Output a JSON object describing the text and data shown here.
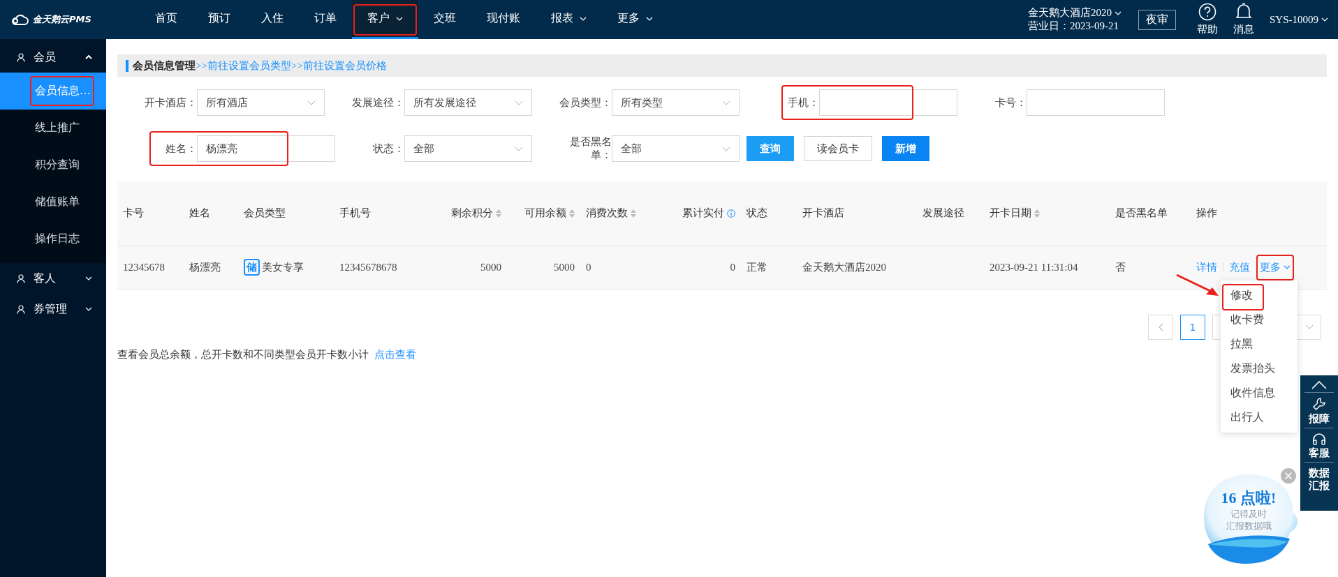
{
  "app": {
    "logo": "金天鹅云PMS"
  },
  "nav": [
    {
      "label": "首页",
      "selected": false,
      "dropdown": false,
      "highlighted": false
    },
    {
      "label": "预订",
      "selected": false,
      "dropdown": false,
      "highlighted": false
    },
    {
      "label": "入住",
      "selected": false,
      "dropdown": false,
      "highlighted": false
    },
    {
      "label": "订单",
      "selected": false,
      "dropdown": false,
      "highlighted": false
    },
    {
      "label": "客户",
      "selected": true,
      "dropdown": true,
      "highlighted": true
    },
    {
      "label": "交班",
      "selected": false,
      "dropdown": false,
      "highlighted": false
    },
    {
      "label": "现付账",
      "selected": false,
      "dropdown": false,
      "highlighted": false
    },
    {
      "label": "报表",
      "selected": false,
      "dropdown": true,
      "highlighted": false
    },
    {
      "label": "更多",
      "selected": false,
      "dropdown": true,
      "highlighted": false
    }
  ],
  "hotel": {
    "name": "金天鹅大酒店2020",
    "business_date": "营业日：2023-09-21"
  },
  "night_audit": "夜审",
  "help": "帮助",
  "messages": "消息",
  "user": "SYS-10009",
  "sidebar": [
    {
      "label": "会员",
      "expanded": true,
      "children": [
        {
          "label": "会员信息…",
          "selected": true,
          "highlighted": true
        },
        {
          "label": "线上推广",
          "selected": false,
          "highlighted": false
        },
        {
          "label": "积分查询",
          "selected": false,
          "highlighted": false
        },
        {
          "label": "储值账单",
          "selected": false,
          "highlighted": false
        },
        {
          "label": "操作日志",
          "selected": false,
          "highlighted": false
        }
      ]
    },
    {
      "label": "客人",
      "expanded": false
    },
    {
      "label": "券管理",
      "expanded": false
    }
  ],
  "breadcrumb": {
    "title": "会员信息管理",
    "links": [
      ">>前往设置会员类型",
      ">>前往设置会员价格"
    ]
  },
  "filters": [
    {
      "kind": "select",
      "label": "开卡酒店：",
      "value": "所有酒店",
      "highlighted": false
    },
    {
      "kind": "select",
      "label": "发展途径：",
      "value": "所有发展途径",
      "highlighted": false
    },
    {
      "kind": "select",
      "label": "会员类型：",
      "value": "所有类型",
      "highlighted": false
    },
    {
      "kind": "input",
      "label": "手机：",
      "highlighted": true
    },
    {
      "kind": "input",
      "label": "卡号：",
      "highlighted": false
    },
    {
      "kind": "input",
      "label": "姓名：",
      "value": "杨漂亮",
      "highlighted": true
    },
    {
      "kind": "select",
      "label": "状态：",
      "value": "全部",
      "highlighted": false
    },
    {
      "kind": "select",
      "label": "是否黑名单：",
      "value": "全部",
      "highlighted": false
    }
  ],
  "buttons": [
    {
      "label": "查询",
      "kind": "primary"
    },
    {
      "label": "读会员卡",
      "kind": "default"
    },
    {
      "label": "新增",
      "kind": "accent"
    }
  ],
  "table": {
    "columns": [
      {
        "label": "卡号",
        "sortable": false,
        "info": false
      },
      {
        "label": "姓名",
        "sortable": false,
        "info": false
      },
      {
        "label": "会员类型",
        "sortable": false,
        "info": false
      },
      {
        "label": "手机号",
        "sortable": false,
        "info": false
      },
      {
        "label": "剩余积分",
        "sortable": true,
        "info": false
      },
      {
        "label": "可用余额",
        "sortable": true,
        "info": false
      },
      {
        "label": "消费次数",
        "sortable": true,
        "info": false
      },
      {
        "label": "累计实付",
        "sortable": false,
        "info": true
      },
      {
        "label": "状态",
        "sortable": false,
        "info": false
      },
      {
        "label": "开卡酒店",
        "sortable": false,
        "info": false
      },
      {
        "label": "发展途径",
        "sortable": false,
        "info": false
      },
      {
        "label": "开卡日期",
        "sortable": true,
        "info": false
      },
      {
        "label": "是否黑名单",
        "sortable": false,
        "info": false
      },
      {
        "label": "操作",
        "sortable": false,
        "info": false
      }
    ],
    "rows": [
      {
        "card_no": "12345678",
        "name": "杨漂亮",
        "type_tag": "储",
        "member_type": "美女专享",
        "phone": "12345678678",
        "points": "5000",
        "balance": "5000",
        "visits": "0",
        "total_paid": "0",
        "status": "正常",
        "hotel": "金天鹅大酒店2020",
        "open_date": "2023-09-21 11:31:04",
        "blacklisted": "否",
        "actions": [
          "详情",
          "充值"
        ],
        "more": {
          "label": "更多",
          "highlighted": true
        }
      }
    ]
  },
  "pagination": {
    "pages": [
      {
        "label": "1",
        "selected": true
      }
    ]
  },
  "more_menu": [
    {
      "label": "修改",
      "highlighted": true
    },
    {
      "label": "收卡费",
      "highlighted": false
    },
    {
      "label": "拉黑",
      "highlighted": false
    },
    {
      "label": "发票抬头",
      "highlighted": false
    },
    {
      "label": "收件信息",
      "highlighted": false
    },
    {
      "label": "出行人",
      "highlighted": false
    }
  ],
  "footer": {
    "text": "查看会员总余额，总开卡数和不同类型会员开卡数小计",
    "link": "点击查看"
  },
  "side_tools": [
    {
      "kind": "report",
      "label": "报障"
    },
    {
      "kind": "service",
      "label": "客服"
    },
    {
      "kind": "data",
      "label": "数据汇报"
    }
  ],
  "reminder": {
    "headline": "16 点啦!",
    "lines": [
      "记得及时",
      "汇报数据哦"
    ]
  }
}
